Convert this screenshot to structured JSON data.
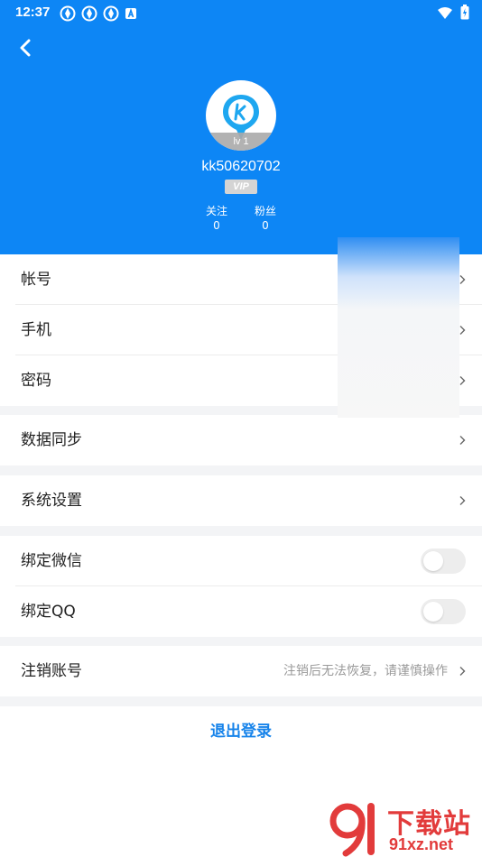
{
  "status_bar": {
    "time": "12:37"
  },
  "profile": {
    "level": "lv 1",
    "username": "kk50620702",
    "vip": "VIP",
    "follow_label": "关注",
    "follow_count": "0",
    "fans_label": "粉丝",
    "fans_count": "0"
  },
  "menu": {
    "account": "帐号",
    "phone": "手机",
    "password": "密码",
    "sync": "数据同步",
    "settings": "系统设置",
    "bind_wechat": "绑定微信",
    "bind_qq": "绑定QQ",
    "deactivate": "注销账号",
    "deactivate_hint": "注销后无法恢复，请谨慎操作"
  },
  "toggles": {
    "wechat_on": false,
    "qq_on": false
  },
  "logout_label": "退出登录",
  "watermark": {
    "main": "下载站",
    "domain": "91xz.net"
  },
  "colors": {
    "header_blue": "#0d86f5",
    "link_blue": "#1683ea",
    "watermark_red": "#e23b3b"
  }
}
